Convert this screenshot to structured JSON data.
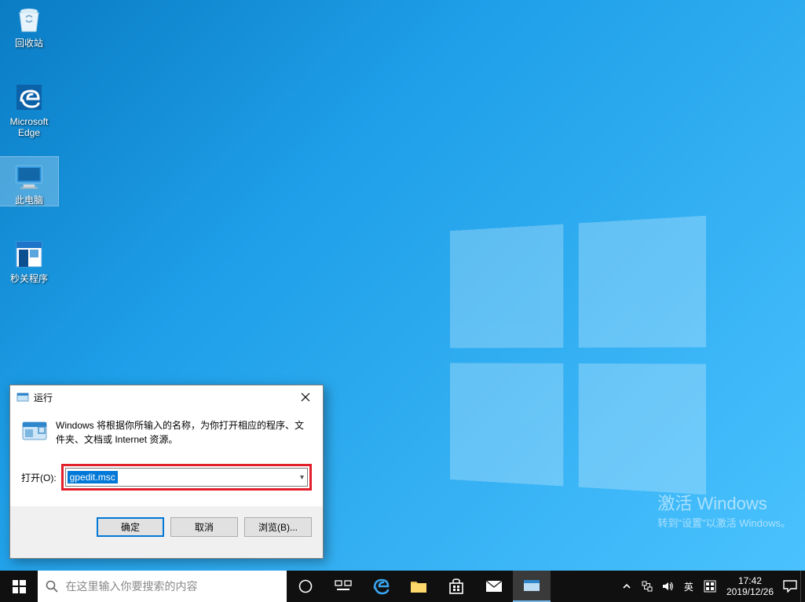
{
  "desktop_icons": {
    "recycle_bin": "回收站",
    "edge": "Microsoft\nEdge",
    "this_pc": "此电脑",
    "shutdown_app": "秒关程序"
  },
  "activation": {
    "title": "激活 Windows",
    "subtitle": "转到\"设置\"以激活 Windows。"
  },
  "run_dialog": {
    "title": "运行",
    "description": "Windows 将根据你所输入的名称，为你打开相应的程序、文件夹、文档或 Internet 资源。",
    "open_label": "打开(O):",
    "input_value": "gpedit.msc",
    "ok": "确定",
    "cancel": "取消",
    "browse": "浏览(B)..."
  },
  "taskbar": {
    "search_placeholder": "在这里输入你要搜索的内容",
    "ime": "英",
    "time": "17:42",
    "date": "2019/12/26"
  }
}
